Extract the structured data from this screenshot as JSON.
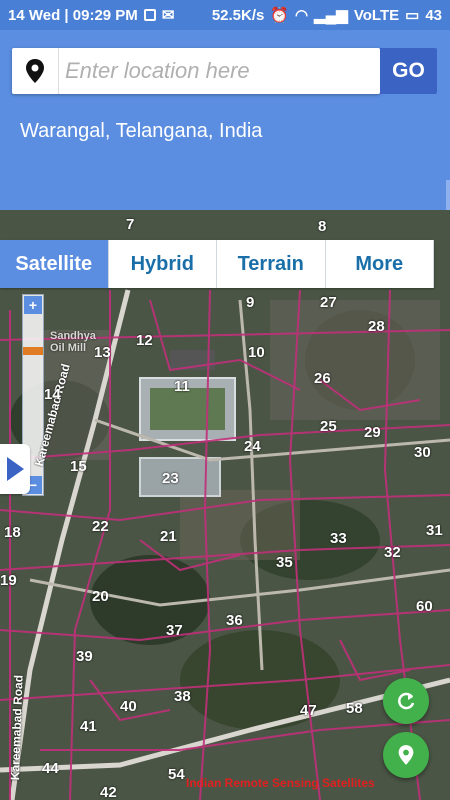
{
  "status_bar": {
    "date_time": "14 Wed | 09:29 PM",
    "speed": "52.5K/s",
    "network": "VoLTE",
    "battery": "43"
  },
  "search": {
    "placeholder": "Enter location here",
    "value": "",
    "go_label": "GO"
  },
  "location_text": "Warangal, Telangana, India",
  "map_tabs": [
    {
      "label": "Satellite",
      "active": true
    },
    {
      "label": "Hybrid",
      "active": false
    },
    {
      "label": "Terrain",
      "active": false
    },
    {
      "label": "More",
      "active": false
    }
  ],
  "zoom": {
    "plus": "+",
    "minus": "−"
  },
  "plots": [
    "7",
    "8",
    "9",
    "27",
    "28",
    "12",
    "13",
    "10",
    "26",
    "11",
    "14",
    "25",
    "29",
    "24",
    "15",
    "30",
    "23",
    "18",
    "22",
    "21",
    "33",
    "31",
    "32",
    "35",
    "19",
    "20",
    "60",
    "37",
    "36",
    "39",
    "40",
    "38",
    "47",
    "58",
    "41",
    "44",
    "54",
    "42"
  ],
  "road_labels": [
    "Kareemabad Road",
    "Kareemabad Road"
  ],
  "mill_label": "Sandhya Oil Mill",
  "watermark": "Indian Remote Sensing Satellites",
  "colors": {
    "accent": "#5b8de0",
    "go": "#3a63c4",
    "fab": "#43b14b",
    "boundary": "#c0307a"
  }
}
